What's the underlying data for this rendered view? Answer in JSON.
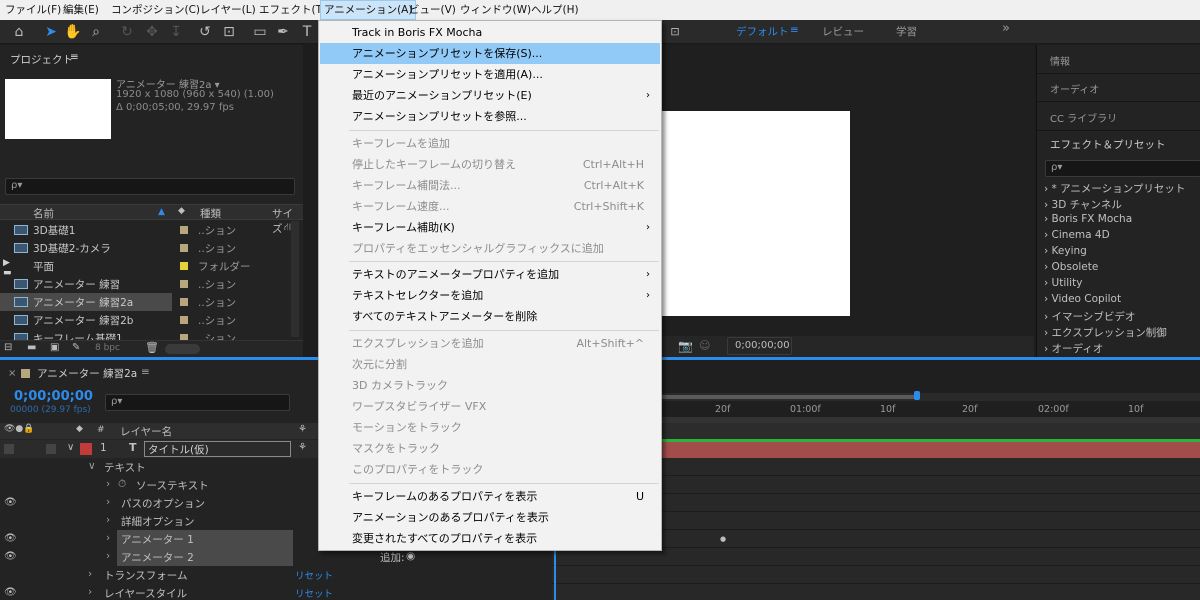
{
  "menubar": [
    "ファイル(F)",
    "編集(E)",
    "コンポジション(C)",
    "レイヤー(L)",
    "エフェクト(T)",
    "アニメーション(A)",
    "ビュー(V)",
    "ウィンドウ(W)",
    "ヘルプ(H)"
  ],
  "workspace": {
    "active": "デフォルト",
    "items": [
      "レビュー",
      "学習"
    ],
    "more": "»"
  },
  "project": {
    "title": "プロジェクト",
    "comp_name": "アニメーター 練習2a ▾",
    "comp_size": "1920 x 1080  (960 x 540) (1.00)",
    "comp_dur": "Δ 0;00;05;00, 29.97 fps",
    "search_icon": "ρ▾",
    "columns": [
      "名前",
      "種類",
      "サイズ"
    ],
    "rows": [
      {
        "name": "3D基礎1",
        "type": "..ション"
      },
      {
        "name": "3D基礎2-カメラ",
        "type": "..ション"
      },
      {
        "name": "平面",
        "type": "フォルダー"
      },
      {
        "name": "アニメーター 練習",
        "type": "..ション"
      },
      {
        "name": "アニメーター 練習2a",
        "type": "..ション"
      },
      {
        "name": "アニメーター 練習2b",
        "type": "..ション"
      },
      {
        "name": "キーフレーム基礎1",
        "type": "..ション"
      }
    ],
    "bpc": "8 bpc"
  },
  "menu": {
    "items": [
      {
        "label": "Track in Boris FX Mocha",
        "shortcut": "",
        "disabled": false,
        "submenu": false,
        "highlight": false
      },
      {
        "label": "アニメーションプリセットを保存(S)...",
        "shortcut": "",
        "disabled": false,
        "submenu": false,
        "highlight": true
      },
      {
        "label": "アニメーションプリセットを適用(A)...",
        "shortcut": "",
        "disabled": false,
        "submenu": false,
        "highlight": false
      },
      {
        "label": "最近のアニメーションプリセット(E)",
        "shortcut": "",
        "disabled": false,
        "submenu": true,
        "highlight": false
      },
      {
        "label": "アニメーションプリセットを参照...",
        "shortcut": "",
        "disabled": false,
        "submenu": false,
        "highlight": false
      },
      {
        "label": "キーフレームを追加",
        "shortcut": "",
        "disabled": true,
        "submenu": false,
        "highlight": false
      },
      {
        "label": "停止したキーフレームの切り替え",
        "shortcut": "Ctrl+Alt+H",
        "disabled": true,
        "submenu": false,
        "highlight": false
      },
      {
        "label": "キーフレーム補間法...",
        "shortcut": "Ctrl+Alt+K",
        "disabled": true,
        "submenu": false,
        "highlight": false
      },
      {
        "label": "キーフレーム速度...",
        "shortcut": "Ctrl+Shift+K",
        "disabled": true,
        "submenu": false,
        "highlight": false
      },
      {
        "label": "キーフレーム補助(K)",
        "shortcut": "",
        "disabled": false,
        "submenu": true,
        "highlight": false
      },
      {
        "label": "プロパティをエッセンシャルグラフィックスに追加",
        "shortcut": "",
        "disabled": true,
        "submenu": false,
        "highlight": false
      },
      {
        "label": "テキストのアニメータープロパティを追加",
        "shortcut": "",
        "disabled": false,
        "submenu": true,
        "highlight": false
      },
      {
        "label": "テキストセレクターを追加",
        "shortcut": "",
        "disabled": false,
        "submenu": true,
        "highlight": false
      },
      {
        "label": "すべてのテキストアニメーターを削除",
        "shortcut": "",
        "disabled": false,
        "submenu": false,
        "highlight": false
      },
      {
        "label": "エクスプレッションを追加",
        "shortcut": "Alt+Shift+^",
        "disabled": true,
        "submenu": false,
        "highlight": false
      },
      {
        "label": "次元に分割",
        "shortcut": "",
        "disabled": true,
        "submenu": false,
        "highlight": false
      },
      {
        "label": "3D カメラトラック",
        "shortcut": "",
        "disabled": true,
        "submenu": false,
        "highlight": false
      },
      {
        "label": "ワープスタビライザー VFX",
        "shortcut": "",
        "disabled": true,
        "submenu": false,
        "highlight": false
      },
      {
        "label": "モーションをトラック",
        "shortcut": "",
        "disabled": true,
        "submenu": false,
        "highlight": false
      },
      {
        "label": "マスクをトラック",
        "shortcut": "",
        "disabled": true,
        "submenu": false,
        "highlight": false
      },
      {
        "label": "このプロパティをトラック",
        "shortcut": "",
        "disabled": true,
        "submenu": false,
        "highlight": false
      },
      {
        "label": "キーフレームのあるプロパティを表示",
        "shortcut": "U",
        "disabled": false,
        "submenu": false,
        "highlight": false
      },
      {
        "label": "アニメーションのあるプロパティを表示",
        "shortcut": "",
        "disabled": false,
        "submenu": false,
        "highlight": false
      },
      {
        "label": "変更されたすべてのプロパティを表示",
        "shortcut": "",
        "disabled": false,
        "submenu": false,
        "highlight": false
      }
    ]
  },
  "comp_viewer": {
    "timecode": "0;00;00;00"
  },
  "right_panel": {
    "headers": [
      "情報",
      "オーディオ",
      "CC ライブラリ"
    ],
    "effects_title": "エフェクト＆プリセット",
    "search_icon": "ρ▾",
    "categories": [
      "* アニメーションプリセット",
      "3D チャンネル",
      "Boris FX Mocha",
      "Cinema 4D",
      "Keying",
      "Obsolete",
      "Utility",
      "Video Copilot",
      "イマーシブビデオ",
      "エクスプレッション制御",
      "オーディオ"
    ]
  },
  "timeline": {
    "tab": "アニメーター 練習2a",
    "timecode": "0;00;00;00",
    "frames": "00000 (29.97 fps)",
    "search_icon": "ρ▾",
    "col_num": "#",
    "col_layer": "レイヤー名",
    "layer_num": "1",
    "layer_type": "T",
    "layer_name": "タイトル(仮)",
    "props": [
      "テキスト",
      "ソーステキスト",
      "パスのオプション",
      "詳細オプション",
      "アニメーター 1",
      "アニメーター 2",
      "トランスフォーム",
      "レイヤースタイル"
    ],
    "reset": "リセット",
    "add": "追加:",
    "ticks": [
      "20f",
      "01:00f",
      "10f",
      "20f",
      "02:00f",
      "10f"
    ]
  }
}
